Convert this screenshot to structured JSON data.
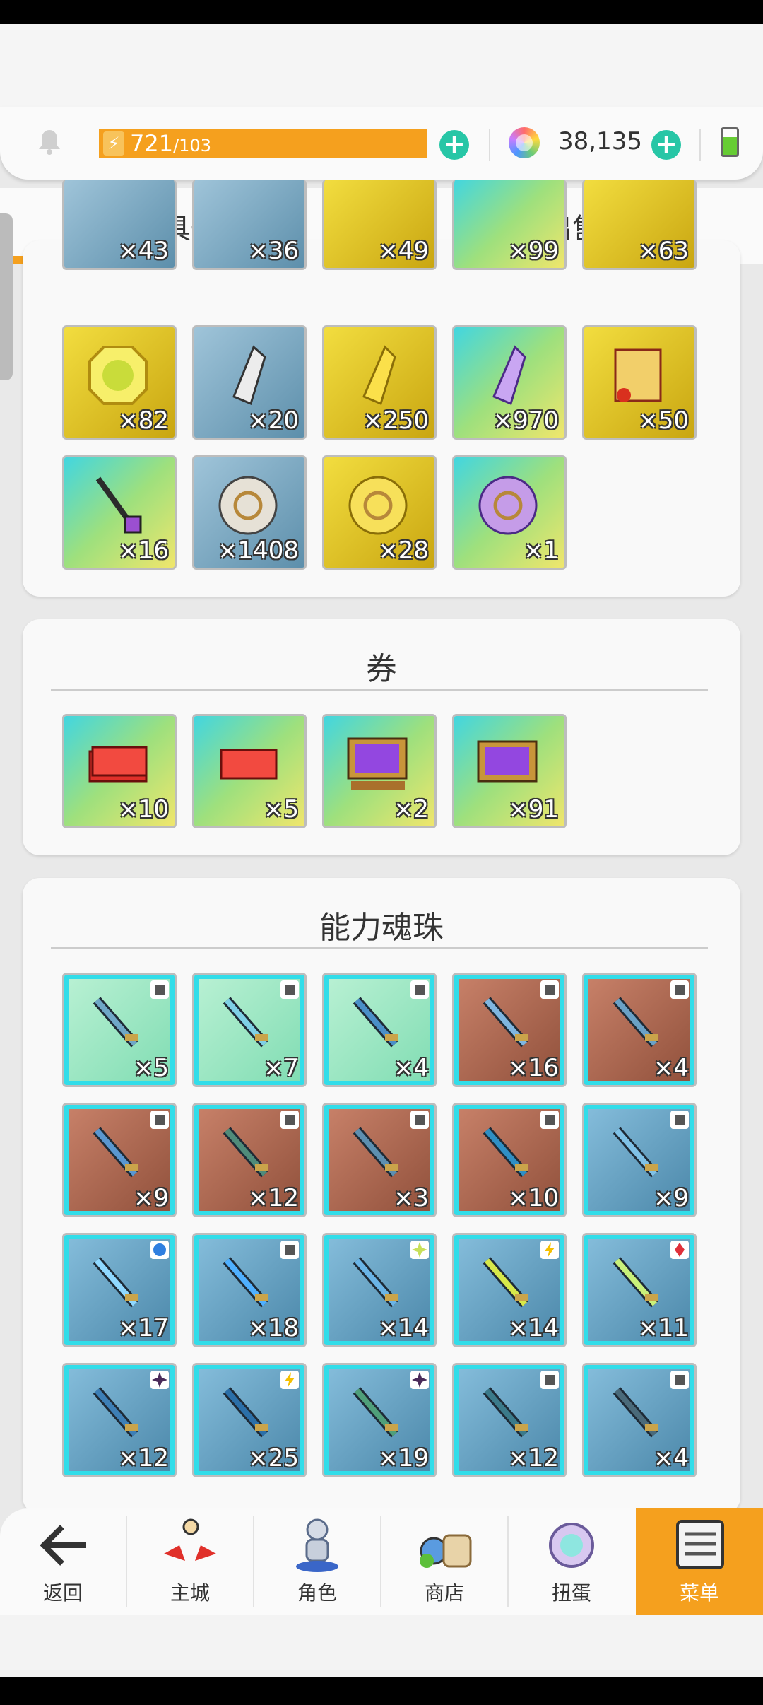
{
  "status": {
    "energy_current": "721",
    "energy_max": "/103",
    "currency": "38,135"
  },
  "tabs": [
    {
      "label": "道具一览",
      "active": true
    },
    {
      "label": "出售",
      "active": false
    }
  ],
  "materials": {
    "counts_partial_row": [
      "×43",
      "×36",
      "×49",
      "×99",
      "×63"
    ],
    "items": [
      {
        "name": "gold-coin",
        "count": "×82"
      },
      {
        "name": "silver-shard",
        "count": "×20"
      },
      {
        "name": "gold-shard",
        "count": "×250"
      },
      {
        "name": "violet-shard",
        "count": "×970"
      },
      {
        "name": "scroll",
        "count": "×50"
      },
      {
        "name": "staff",
        "count": "×16"
      },
      {
        "name": "silver-emblem",
        "count": "×1408"
      },
      {
        "name": "gold-emblem",
        "count": "×28"
      },
      {
        "name": "violet-emblem",
        "count": "×1"
      }
    ]
  },
  "tickets": {
    "title": "券",
    "items": [
      {
        "name": "red-ticket-stack",
        "count": "×10"
      },
      {
        "name": "red-ticket",
        "count": "×5"
      },
      {
        "name": "purple-ticket-stack",
        "count": "×2"
      },
      {
        "name": "purple-ticket",
        "count": "×91"
      }
    ]
  },
  "orbs": {
    "title": "能力魂珠",
    "items": [
      {
        "name": "dagger",
        "count": "×5"
      },
      {
        "name": "wand",
        "count": "×7"
      },
      {
        "name": "shield",
        "count": "×4"
      },
      {
        "name": "sword",
        "count": "×16"
      },
      {
        "name": "axe",
        "count": "×4"
      },
      {
        "name": "spear",
        "count": "×9"
      },
      {
        "name": "bow",
        "count": "×12"
      },
      {
        "name": "book",
        "count": "×3"
      },
      {
        "name": "gauntlet",
        "count": "×10"
      },
      {
        "name": "greatsword",
        "count": "×9"
      },
      {
        "name": "ice-sword",
        "count": "×17"
      },
      {
        "name": "ice-blade",
        "count": "×18"
      },
      {
        "name": "ice-kris",
        "count": "×14"
      },
      {
        "name": "lightning-blade",
        "count": "×14"
      },
      {
        "name": "fire-sword",
        "count": "×11"
      },
      {
        "name": "dark-blade",
        "count": "×12"
      },
      {
        "name": "pickaxe",
        "count": "×25"
      },
      {
        "name": "battle-axe",
        "count": "×19"
      },
      {
        "name": "dark-axe",
        "count": "×12"
      },
      {
        "name": "dark-spear",
        "count": "×4"
      }
    ]
  },
  "nav": [
    {
      "label": "返回"
    },
    {
      "label": "主城"
    },
    {
      "label": "角色"
    },
    {
      "label": "商店"
    },
    {
      "label": "扭蛋"
    },
    {
      "label": "菜单"
    }
  ],
  "colors": {
    "accent": "#f5a01e",
    "plus": "#27c6a6",
    "tile_glow": "#31dde9"
  }
}
